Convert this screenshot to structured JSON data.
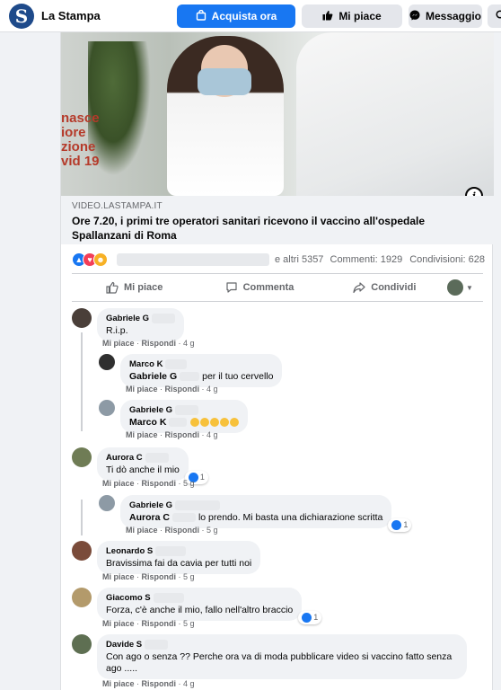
{
  "topbar": {
    "page_name": "La Stampa",
    "buy_label": "Acquista ora",
    "like_label": "Mi piace",
    "message_label": "Messaggio"
  },
  "media": {
    "bg_text": [
      "nasce",
      "iore",
      "zione",
      "vid 19"
    ],
    "source": "VIDEO.LASTAMPA.IT",
    "title": "Ore 7.20, i primi tre operatori sanitari ricevono il vaccino all'ospedale Spallanzani di Roma"
  },
  "stats": {
    "others": "e altri 5357",
    "comments": "Commenti: 1929",
    "shares": "Condivisioni: 628"
  },
  "actions": {
    "like": "Mi piace",
    "comment": "Commenta",
    "share": "Condividi"
  },
  "labels": {
    "like": "Mi piace",
    "reply": "Rispondi"
  },
  "comments": [
    {
      "author": "Gabriele G",
      "mention": "",
      "text": "R.i.p.",
      "time": "4 g",
      "likes": ""
    },
    {
      "author": "Marco K",
      "mention": "Gabriele G",
      "text": "per il tuo cervello",
      "time": "4 g",
      "likes": ""
    },
    {
      "author": "Gabriele G",
      "mention": "Marco K",
      "text": "",
      "time": "4 g",
      "likes": ""
    },
    {
      "author": "Aurora C",
      "mention": "",
      "text": "Ti dò anche il mio",
      "time": "5 g",
      "likes": "1"
    },
    {
      "author": "Gabriele G",
      "mention": "Aurora C",
      "text": "lo prendo. Mi basta una dichiarazione scritta",
      "time": "5 g",
      "likes": "1"
    },
    {
      "author": "Leonardo S",
      "mention": "",
      "text": "Bravissima fai da cavia per tutti noi",
      "time": "5 g",
      "likes": ""
    },
    {
      "author": "Giacomo S",
      "mention": "",
      "text": "Forza, c'è anche il mio, fallo nell'altro braccio",
      "time": "5 g",
      "likes": "1"
    },
    {
      "author": "Davide S",
      "mention": "",
      "text": "Con ago o senza ?? Perche ora va di moda pubblicare video si vaccino fatto senza ago .....",
      "time": "4 g",
      "likes": ""
    }
  ],
  "colors": {
    "accent": "#1877f2",
    "brand": "#1e4a8a",
    "muted": "#65676b"
  }
}
